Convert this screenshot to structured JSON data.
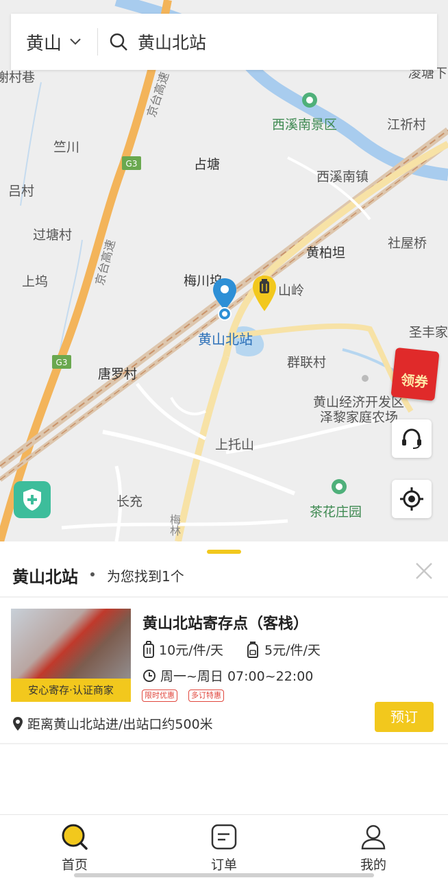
{
  "search": {
    "city": "黄山",
    "query": "黄山北站"
  },
  "map": {
    "labels": {
      "xiecunxiang": "谢村巷",
      "lingjie": "凌塘下",
      "xixinan_scenic": "西溪南景区",
      "jiangqicun": "江祈村",
      "zhuchuan": "竺川",
      "zhantang": "占塘",
      "xixinan_town": "西溪南镇",
      "lvcun": "吕村",
      "guotangcun": "过塘村",
      "shewuqiao": "社屋桥",
      "huangbaitan": "黄柏坦",
      "shangwu": "上坞",
      "meichuan": "梅川坞",
      "shanling": "山岭",
      "station": "黄山北站",
      "shengfeng": "圣丰家",
      "tangluocun": "唐罗村",
      "qunliancun": "群联村",
      "devzone": "黄山经济开发区",
      "zeli_farm": "泽黎家庭农场",
      "shangtuoshan": "上托山",
      "changchong": "长充",
      "chahua": "茶花庄园",
      "meilin": "梅林",
      "highway_1": "京台高速",
      "highway_2": "京台高速",
      "g3_a": "G3",
      "g3_b": "G3"
    },
    "coupon_label": "领券"
  },
  "sheet": {
    "title": "黄山北站",
    "count_text": "为您找到1个",
    "store": {
      "name": "黄山北站寄存点（客栈）",
      "price_large": "10元/件/天",
      "price_small": "5元/件/天",
      "hours": "周一~周日 07:00~22:00",
      "tags": [
        "限时优惠",
        "多订特惠"
      ],
      "badge": "安心寄存·认证商家",
      "distance": "距离黄山北站进/出站口约500米",
      "book_label": "预订"
    }
  },
  "tabs": [
    {
      "label": "首页",
      "icon": "search-icon",
      "active": true
    },
    {
      "label": "订单",
      "icon": "order-icon",
      "active": false
    },
    {
      "label": "我的",
      "icon": "profile-icon",
      "active": false
    }
  ],
  "colors": {
    "accent": "#f2c81d",
    "pin_blue": "#2d8fd6",
    "shield_green": "#3dbd9b",
    "tag_red": "#e0463c"
  }
}
